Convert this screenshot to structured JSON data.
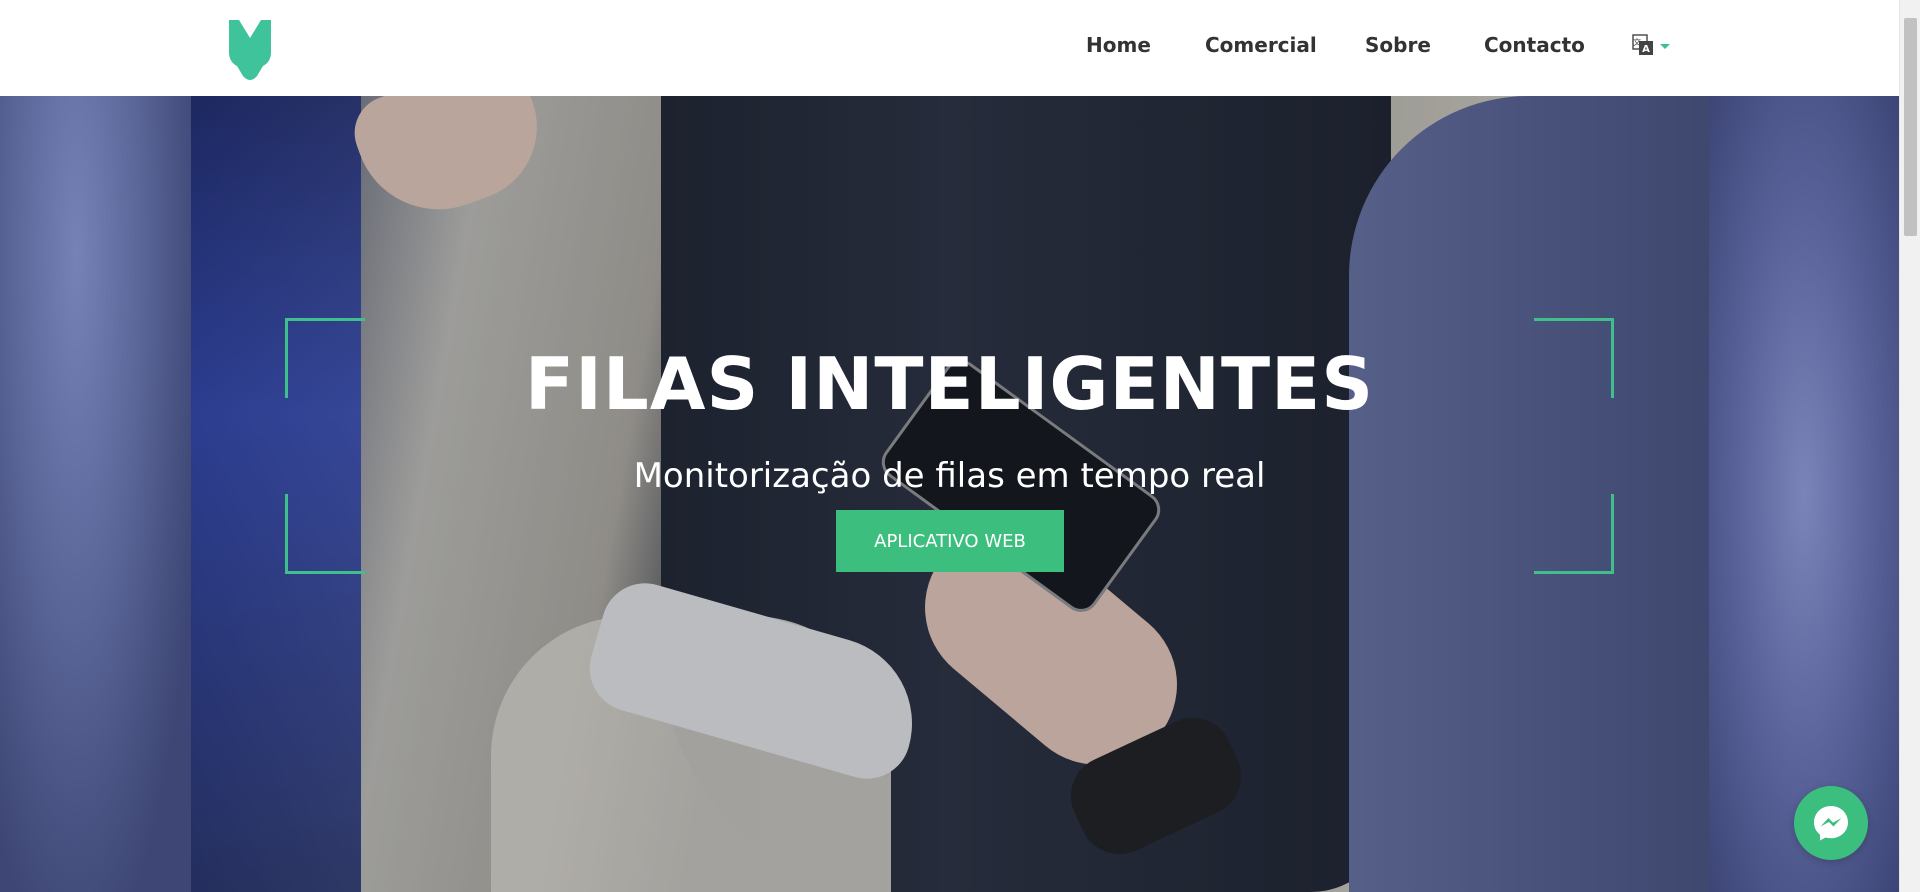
{
  "header": {
    "logo_alt": "V",
    "nav": [
      {
        "label": "Home"
      },
      {
        "label": "Comercial"
      },
      {
        "label": "Sobre"
      },
      {
        "label": "Contacto"
      }
    ],
    "language_icon": "translate-icon"
  },
  "hero": {
    "title": "FILAS INTELIGENTES",
    "subtitle": "Monitorização de filas em tempo real",
    "cta_label": "APLICATIVO WEB"
  },
  "colors": {
    "accent": "#3cbf7e",
    "nav_text": "#333333"
  },
  "widgets": {
    "chat_icon": "messenger-icon"
  }
}
